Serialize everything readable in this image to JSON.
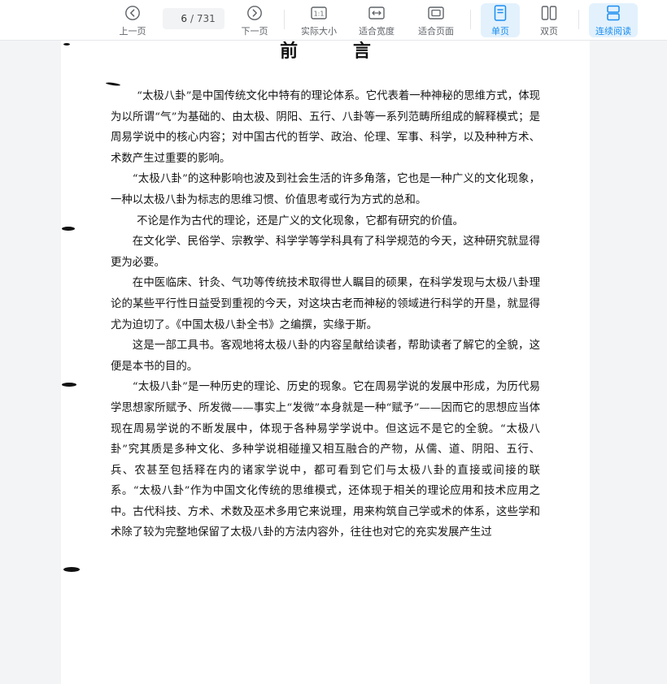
{
  "toolbar": {
    "prev_label": "上一页",
    "page_current": "6",
    "page_total": "/ 731",
    "next_label": "下一页",
    "actual_size_label": "实际大小",
    "fit_width_label": "适合宽度",
    "fit_page_label": "适合页面",
    "single_page_label": "单页",
    "double_page_label": "双页",
    "continuous_label": "连续阅读",
    "icons": {
      "prev": "circle-chevron-left-icon",
      "next": "circle-chevron-right-icon",
      "actual_size": "one-to-one-icon",
      "fit_width": "fit-width-icon",
      "fit_page": "fit-page-icon",
      "single_page": "single-page-icon",
      "double_page": "double-page-icon",
      "continuous": "continuous-scroll-icon"
    },
    "active_color": "#1a8ef0",
    "active_bg": "#e3f1fd"
  },
  "document": {
    "title": "前 言",
    "paragraphs": [
      "“太极八卦”是中国传统文化中特有的理论体系。它代表着一种神秘的思维方式，体现为以所谓“气”为基础的、由太极、阴阳、五行、八卦等一系列范畴所组成的解释模式；是周易学说中的核心内容；对中国古代的哲学、政治、伦理、军事、科学，以及种种方术、术数产生过重要的影响。",
      "“太极八卦”的这种影响也波及到社会生活的许多角落，它也是一种广义的文化现象，一种以太极八卦为标志的思维习惯、价值思考或行为方式的总和。",
      "不论是作为古代的理论，还是广义的文化现象，它都有研究的价值。",
      "在文化学、民俗学、宗教学、科学学等学科具有了科学规范的今天，这种研究就显得更为必要。",
      "在中医临床、针灸、气功等传统技术取得世人瞩目的硕果，在科学发现与太极八卦理论的某些平行性日益受到重视的今天，对这块古老而神秘的领域进行科学的开垦，就显得尤为迫切了。《中国太极八卦全书》之编撰，实缘于斯。",
      "这是一部工具书。客观地将太极八卦的内容呈献给读者，帮助读者了解它的全貌，这便是本书的目的。",
      "“太极八卦”是一种历史的理论、历史的现象。它在周易学说的发展中形成，为历代易学思想家所赋予、所发微——事实上“发微”本身就是一种“赋予”——因而它的思想应当体现在周易学说的不断发展中，体现于各种易学学说中。但这远不是它的全貌。“太极八卦”究其质是多种文化、多种学说相碰撞又相互融合的产物，从儒、道、阴阳、五行、兵、农甚至包括释在内的诸家学说中，都可看到它们与太极八卦的直接或间接的联系。“太极八卦”作为中国文化传统的思维模式，还体现于相关的理论应用和技术应用之中。古代科技、方术、术数及巫术多用它来说理，用来构筑自己学或术的体系，这些学和术除了较为完整地保留了太极八卦的方法内容外，往往也对它的充实发展产生过"
    ]
  }
}
